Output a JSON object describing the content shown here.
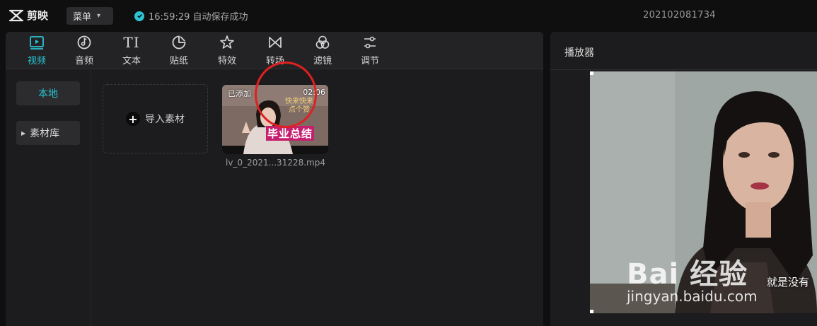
{
  "app": {
    "name": "剪映",
    "menu_label": "菜单"
  },
  "status": {
    "save_text": "16:59:29 自动保存成功"
  },
  "project": {
    "name": "202102081734"
  },
  "toolbar": {
    "video": "视频",
    "audio": "音频",
    "text": "文本",
    "sticker": "贴纸",
    "effects": "特效",
    "transition": "转场",
    "filter": "滤镜",
    "adjust": "调节",
    "text_glyph": "TI"
  },
  "sidebar": {
    "local": "本地",
    "library": "素材库"
  },
  "media": {
    "import_label": "导入素材",
    "clip": {
      "added_badge": "已添加",
      "duration": "02:06",
      "title": "毕业总结",
      "subtitle": "快来快来 点个赞",
      "file_name": "lv_0_2021...31228.mp4"
    }
  },
  "player": {
    "title": "播放器",
    "subtitle": "就是没有",
    "watermark": "Bai 经验",
    "watermark_url": "jingyan.baidu.com"
  },
  "colors": {
    "accent": "#29c3d2",
    "highlight_circle": "#e02020"
  }
}
